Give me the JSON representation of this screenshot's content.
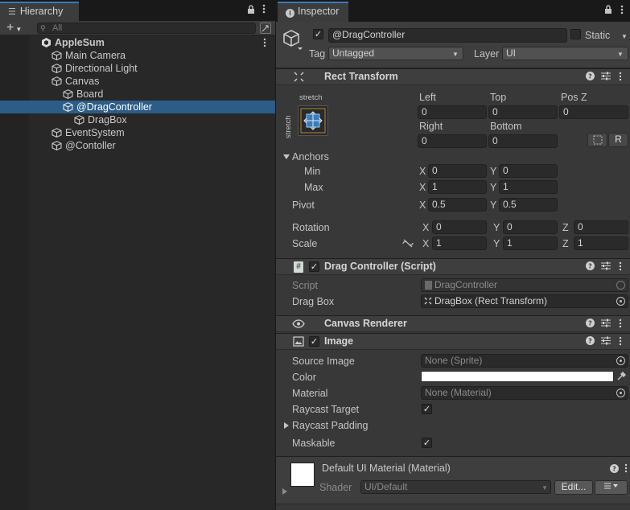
{
  "hierarchy": {
    "tab_label": "Hierarchy",
    "add_label": "+",
    "search_placeholder": "All",
    "items": [
      {
        "label": "AppleSum"
      },
      {
        "label": "Main Camera"
      },
      {
        "label": "Directional Light"
      },
      {
        "label": "Canvas"
      },
      {
        "label": "Board"
      },
      {
        "label": "@DragController"
      },
      {
        "label": "DragBox"
      },
      {
        "label": "EventSystem"
      },
      {
        "label": "@Contoller"
      }
    ]
  },
  "inspector": {
    "tab_label": "Inspector",
    "object_name": "@DragController",
    "static_label": "Static",
    "tag_label": "Tag",
    "tag_value": "Untagged",
    "layer_label": "Layer",
    "layer_value": "UI",
    "rect_transform": {
      "title": "Rect Transform",
      "anchor_preset_top": "stretch",
      "anchor_preset_side": "stretch",
      "left_label": "Left",
      "left": "0",
      "top_label": "Top",
      "top": "0",
      "posz_label": "Pos Z",
      "posz": "0",
      "right_label": "Right",
      "right": "0",
      "bottom_label": "Bottom",
      "bottom": "0",
      "r_button": "R",
      "anchors_label": "Anchors",
      "min_label": "Min",
      "min_x": "0",
      "min_y": "0",
      "max_label": "Max",
      "max_x": "1",
      "max_y": "1",
      "pivot_label": "Pivot",
      "pivot_x": "0.5",
      "pivot_y": "0.5",
      "rotation_label": "Rotation",
      "rot_x": "0",
      "rot_y": "0",
      "rot_z": "0",
      "scale_label": "Scale",
      "scale_x": "1",
      "scale_y": "1",
      "scale_z": "1",
      "x": "X",
      "y": "Y",
      "z": "Z"
    },
    "drag_controller": {
      "title": "Drag Controller (Script)",
      "script_label": "Script",
      "script_value": "DragController",
      "dragbox_label": "Drag Box",
      "dragbox_value": "DragBox (Rect Transform)"
    },
    "canvas_renderer": {
      "title": "Canvas Renderer"
    },
    "image": {
      "title": "Image",
      "source_label": "Source Image",
      "source_value": "None (Sprite)",
      "color_label": "Color",
      "color_value": "#ffffff",
      "material_label": "Material",
      "material_value": "None (Material)",
      "raycast_label": "Raycast Target",
      "padding_label": "Raycast Padding",
      "maskable_label": "Maskable"
    },
    "material_block": {
      "title": "Default UI Material (Material)",
      "shader_label": "Shader",
      "shader_value": "UI/Default",
      "edit_button": "Edit..."
    }
  },
  "colors": {
    "accent": "#3a79bb",
    "selection": "#2c5d87",
    "panel": "#383838"
  }
}
